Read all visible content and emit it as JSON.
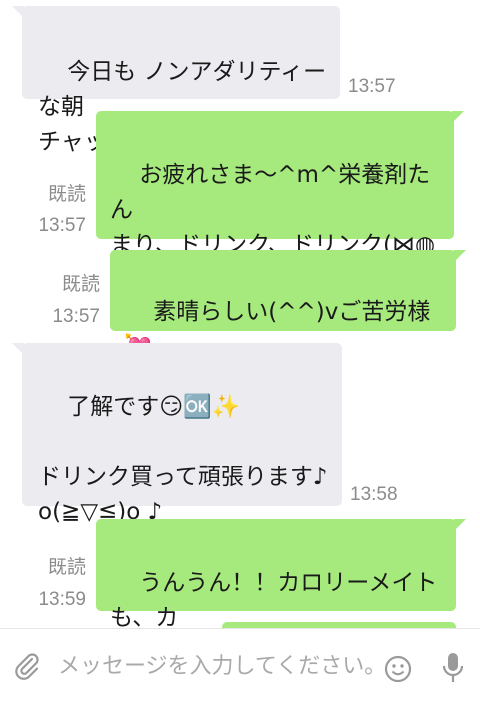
{
  "messages": [
    {
      "from": "in",
      "text": "今日も ノンアダリティーな朝\nチャットでした🎵(笑)",
      "time": "13:57"
    },
    {
      "from": "out",
      "text": "お疲れさま〜^m^栄養剤たん\nまり、ドリンク、ドリンク(⋈◍＞\n◡＜◍)。✧♡",
      "read": "既読",
      "time": "13:57"
    },
    {
      "from": "out",
      "text": "素晴らしい(^^)vご苦労様💘\n💘",
      "read": "既読",
      "time": "13:57"
    },
    {
      "from": "in",
      "text": "了解です😏🆗✨\n\nドリンク買って頑張ります♪\no(≧▽≦)o ♪",
      "time": "13:58"
    },
    {
      "from": "out",
      "text": "うんうん！！カロリーメイトも、カ\nロリーメイトも、カロリーメイトも",
      "read": "既読",
      "time": "13:59"
    }
  ],
  "composer": {
    "placeholder": "メッセージを入力してください。",
    "icons": [
      "paperclip-icon",
      "emoji-icon",
      "microphone-icon"
    ]
  },
  "colors": {
    "incoming": "#ececf0",
    "outgoing": "#a6ea7d",
    "meta": "#8b8b8b"
  }
}
